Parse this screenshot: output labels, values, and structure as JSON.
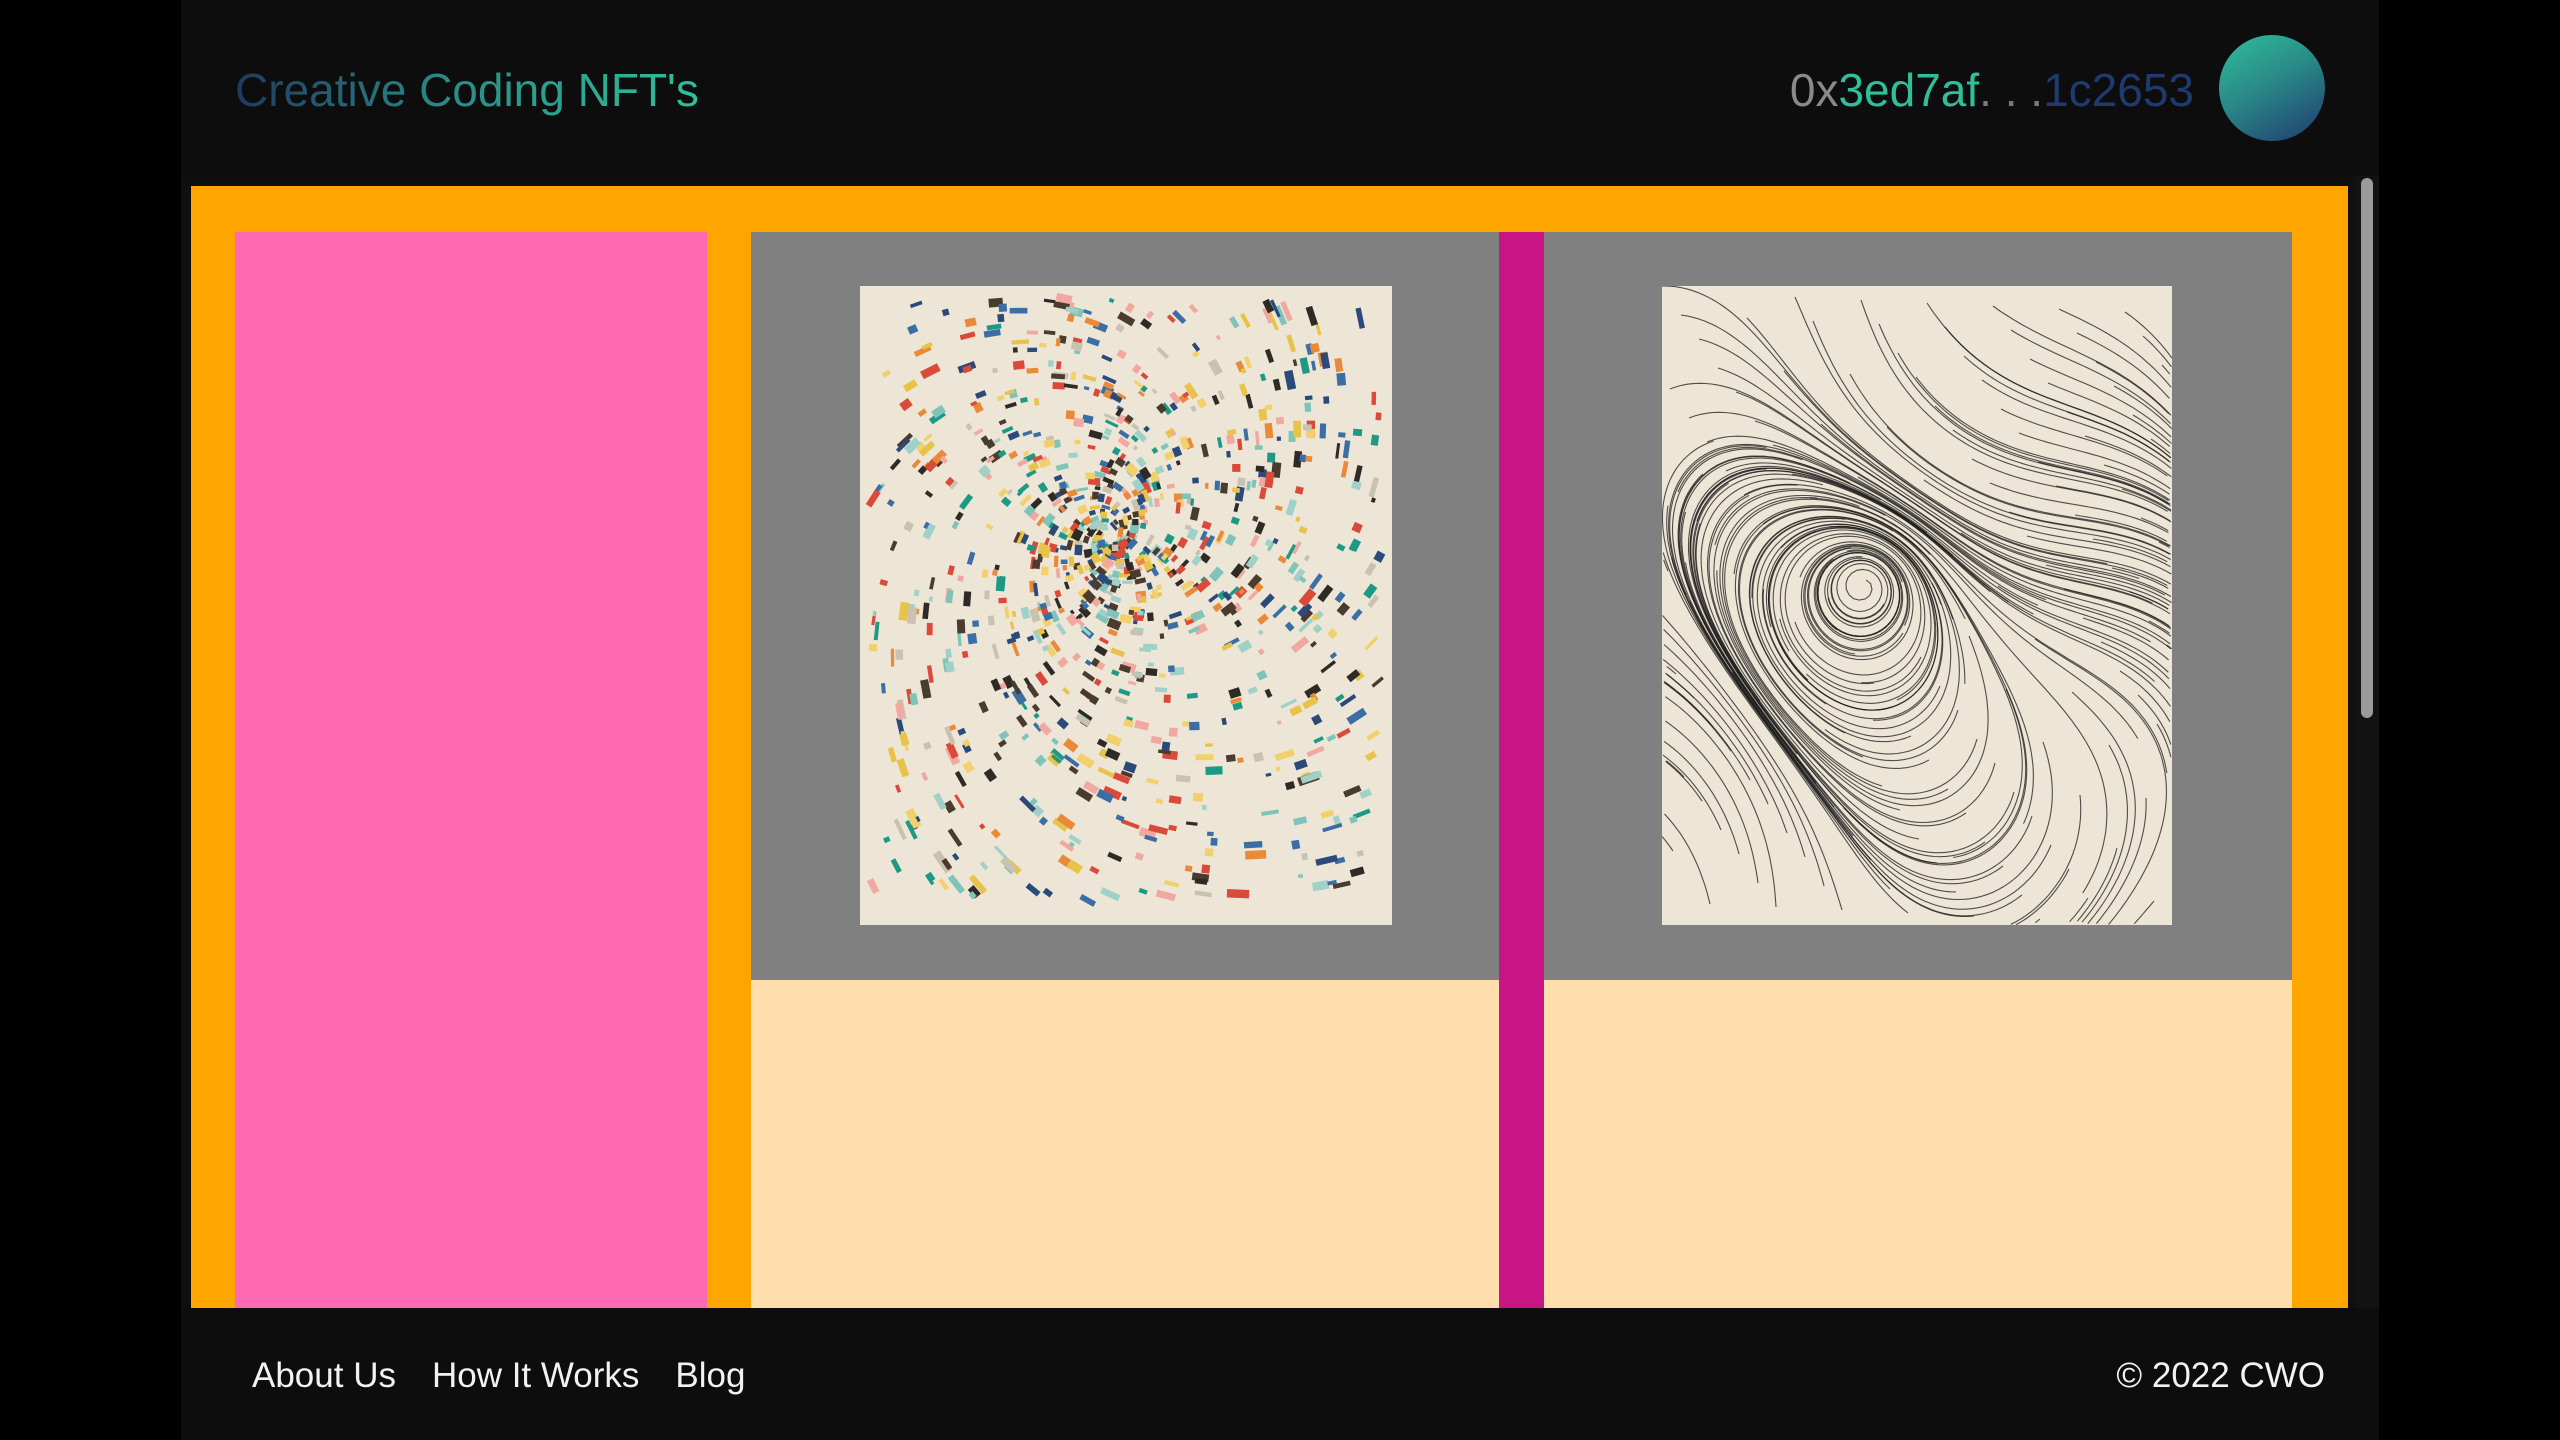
{
  "header": {
    "title": "Creative Coding NFT's",
    "wallet": {
      "prefix": "0x",
      "start": "3ed7af",
      "ellipsis": ". . .",
      "end": "1c2653"
    },
    "avatar_icon": "avatar-orb-icon"
  },
  "cards": [
    {
      "artwork_icon": "colorful-swirl-artwork"
    },
    {
      "artwork_icon": "flow-field-lines-artwork"
    }
  ],
  "footer": {
    "links": [
      "About Us",
      "How It Works",
      "Blog"
    ],
    "copyright": "© 2022 CWO"
  },
  "colors": {
    "page_bg": "#000000",
    "header_bg": "#0d0d0d",
    "main_bg": "#ffa500",
    "sidebar": "#ff69b4",
    "card_bg": "#ffdead",
    "card_media_bg": "#808080",
    "divider": "#c71585",
    "accent_teal": "#2fbf9a",
    "accent_navy": "#1f3a6f"
  }
}
